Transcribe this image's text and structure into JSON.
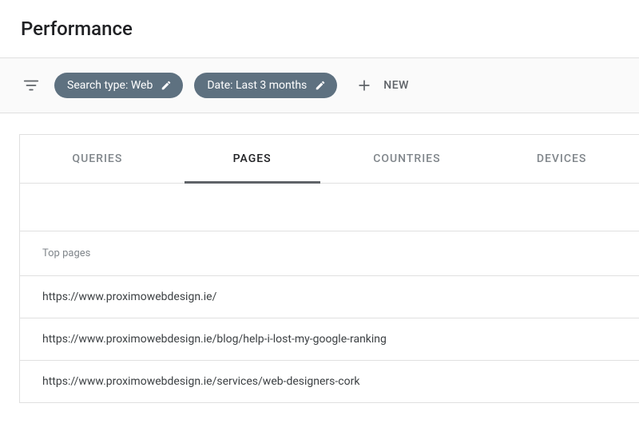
{
  "header": {
    "title": "Performance"
  },
  "filters": {
    "chips": [
      {
        "label": "Search type: Web"
      },
      {
        "label": "Date: Last 3 months"
      }
    ],
    "new_label": "NEW"
  },
  "tabs": [
    {
      "label": "QUERIES",
      "active": false
    },
    {
      "label": "PAGES",
      "active": true
    },
    {
      "label": "COUNTRIES",
      "active": false
    },
    {
      "label": "DEVICES",
      "active": false
    }
  ],
  "table": {
    "header": "Top pages",
    "rows": [
      "https://www.proximowebdesign.ie/",
      "https://www.proximowebdesign.ie/blog/help-i-lost-my-google-ranking",
      "https://www.proximowebdesign.ie/services/web-designers-cork"
    ]
  }
}
